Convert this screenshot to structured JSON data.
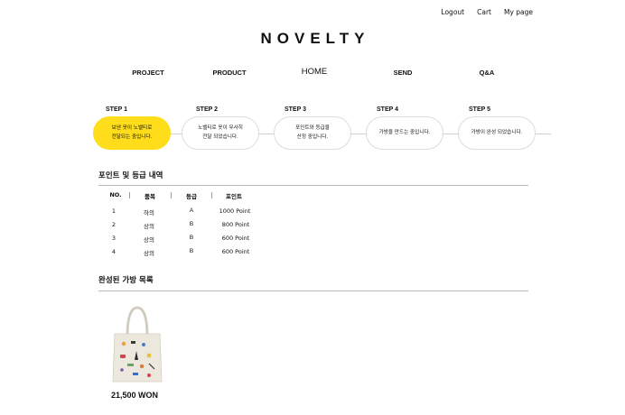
{
  "header": {
    "links": [
      "Logout",
      "Cart",
      "My page"
    ],
    "logo": "NOVELTY"
  },
  "nav": {
    "items": [
      "PROJECT",
      "PRODUCT",
      "HOME",
      "SEND",
      "Q&A"
    ],
    "active": "HOME"
  },
  "steps": [
    {
      "label": "STEP 1",
      "text": "보낸 옷이 노벨티로\n전달되는 중입니다.",
      "active": true
    },
    {
      "label": "STEP 2",
      "text": "노벨티로 옷이 무사히\n전달 되었습니다.",
      "active": false
    },
    {
      "label": "STEP 3",
      "text": "포인트와 등급을\n산정 중입니다.",
      "active": false
    },
    {
      "label": "STEP 4",
      "text": "가방을 만드는 중입니다.",
      "active": false
    },
    {
      "label": "STEP 5",
      "text": "가방이 완성 되었습니다.",
      "active": false
    }
  ],
  "points": {
    "title": "포인트 및 등급 내역",
    "columns": [
      "NO.",
      "품목",
      "등급",
      "포인트"
    ],
    "rows": [
      [
        "1",
        "하의",
        "A",
        "1000 Point"
      ],
      [
        "2",
        "상의",
        "B",
        "800 Point"
      ],
      [
        "3",
        "상의",
        "B",
        "600 Point"
      ],
      [
        "4",
        "상의",
        "B",
        "600 Point"
      ]
    ]
  },
  "bags": {
    "title": "완성된 가방 목록",
    "items": [
      {
        "price": "21,500 WON"
      }
    ]
  },
  "colors": {
    "accent": "#ffdd1a",
    "border": "#dcdcdc",
    "line": "#bdbdbd"
  }
}
